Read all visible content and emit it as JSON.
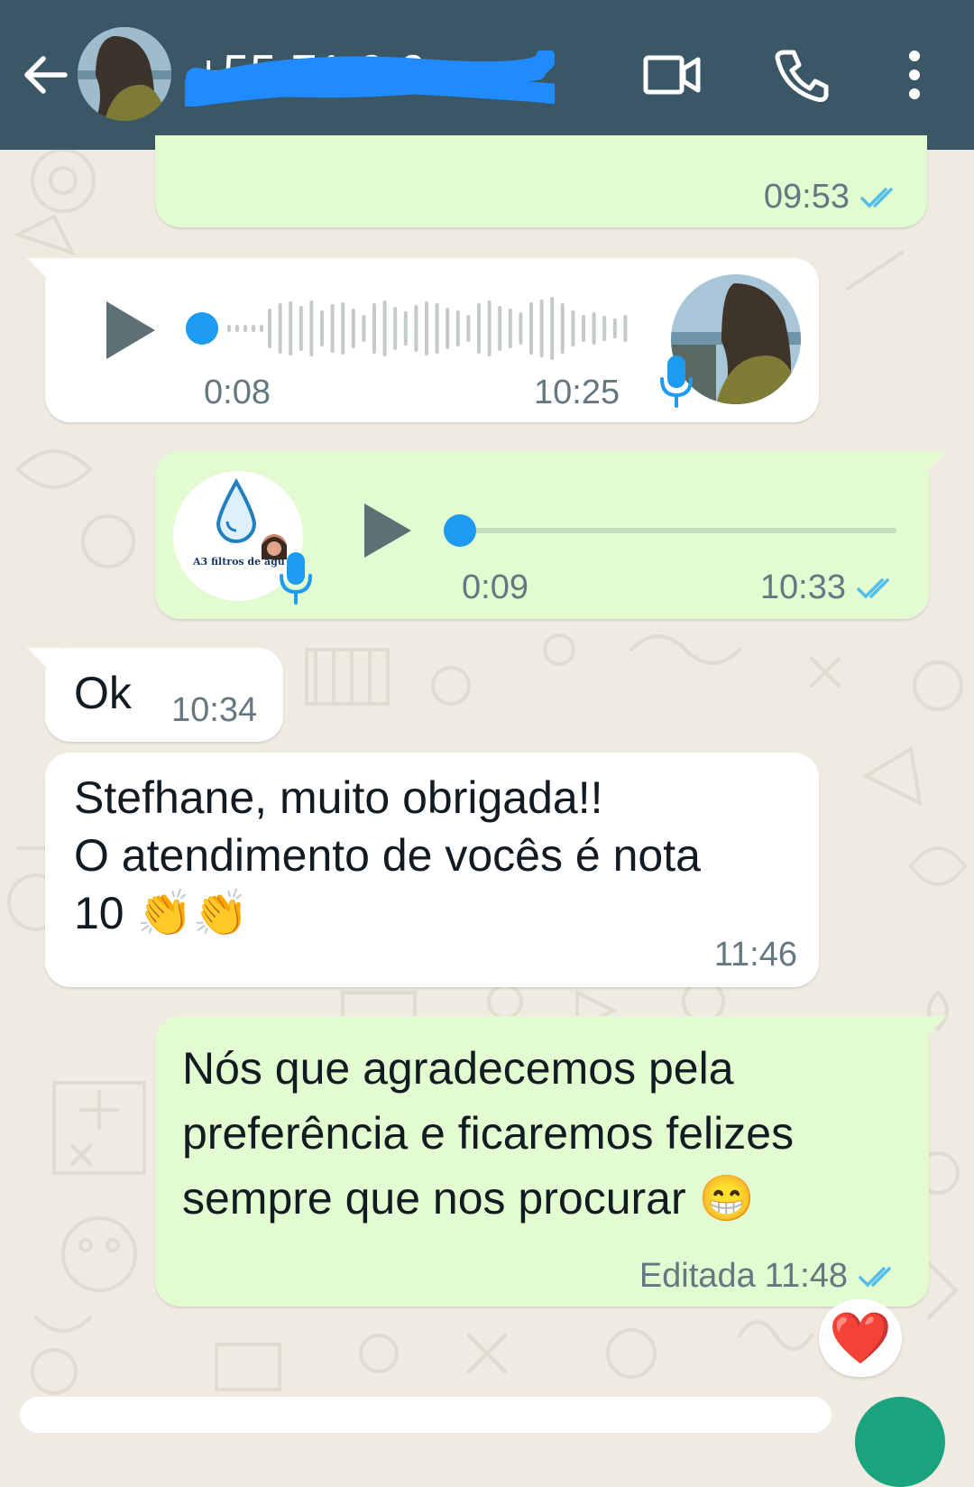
{
  "header": {
    "title": "+55 71 9 0",
    "back_icon": "arrow-left-icon",
    "video_icon": "video-camera-icon",
    "call_icon": "phone-icon",
    "menu_icon": "more-vert-icon",
    "color": "#3b5766"
  },
  "messages": [
    {
      "type": "outgoing_cut",
      "time": "09:53",
      "status": "read"
    },
    {
      "type": "incoming_voice",
      "played": "0:08",
      "time": "10:25"
    },
    {
      "type": "outgoing_voice",
      "duration": "0:09",
      "time": "10:33",
      "avatar_caption": "A3 filtros de águ",
      "status": "read"
    },
    {
      "type": "incoming_text",
      "text": "Ok",
      "time": "10:34"
    },
    {
      "type": "incoming_text",
      "text": "Stefhane, muito obrigada!!\nO atendimento de vocês é nota\n10 👏👏",
      "time": "11:46"
    },
    {
      "type": "outgoing_text",
      "text": "Nós que agradecemos pela\npreferência e ficaremos felizes\nsempre que nos procurar 😁",
      "edited_label": "Editada",
      "time": "11:48",
      "status": "read",
      "reaction": "❤️"
    }
  ],
  "colors": {
    "outgoing_bubble": "#e2fbd0",
    "incoming_bubble": "#ffffff",
    "tick_blue": "#53bdeb",
    "accent_green": "#1aa37f",
    "progress_blue": "#1d9bf0"
  }
}
